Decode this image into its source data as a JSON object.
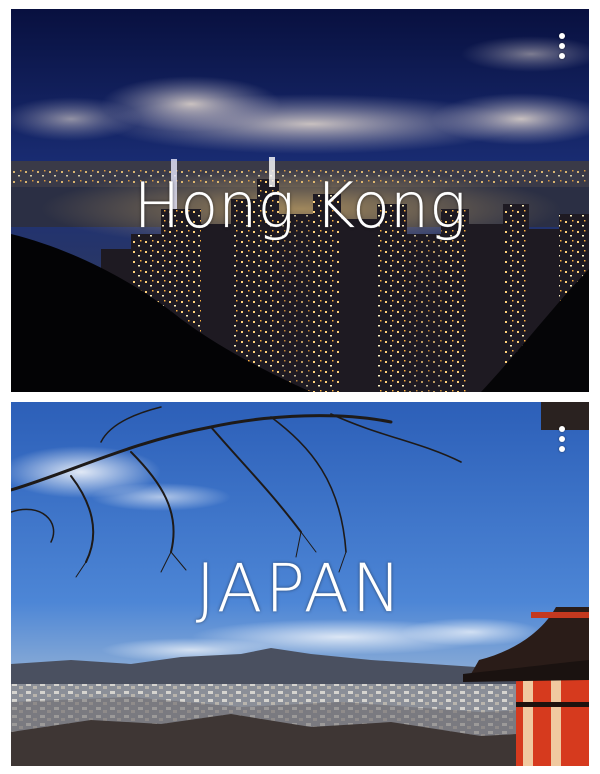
{
  "cards": [
    {
      "title": "Hong Kong",
      "menu_icon": "more-vert-icon",
      "colors": {
        "sky": "#0b1240",
        "glow": "#f0c060"
      }
    },
    {
      "title": "JAPAN",
      "menu_icon": "more-vert-icon",
      "colors": {
        "sky": "#3d72c8",
        "temple": "#d63a1e"
      }
    }
  ]
}
